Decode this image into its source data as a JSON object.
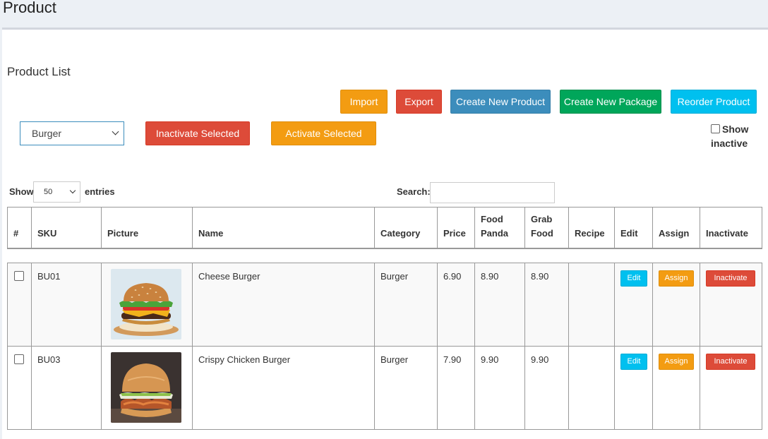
{
  "page": {
    "title": "Product"
  },
  "box": {
    "title": "Product List"
  },
  "toolbar": {
    "import_label": "Import",
    "export_label": "Export",
    "create_product_label": "Create New Product",
    "create_package_label": "Create New Package",
    "reorder_label": "Reorder Product",
    "category_selected": "Burger",
    "inactivate_selected_label": "Inactivate Selected",
    "activate_selected_label": "Activate Selected",
    "show_inactive_label": "Show inactive"
  },
  "datatable": {
    "show_label": "Show",
    "entries_value": "50",
    "entries_label": "entries",
    "search_label": "Search:",
    "search_value": ""
  },
  "table": {
    "headers": [
      "#",
      "SKU",
      "Picture",
      "Name",
      "Category",
      "Price",
      "Food Panda",
      "Grab Food",
      "Recipe",
      "Edit",
      "Assign",
      "Inactivate"
    ],
    "rows": [
      {
        "sku": "BU01",
        "picture": "cheese-burger-image",
        "name": "Cheese Burger",
        "category": "Burger",
        "price": "6.90",
        "food_panda": "8.90",
        "grab_food": "8.90",
        "recipe": "",
        "edit": "Edit",
        "assign": "Assign",
        "inactivate": "Inactivate"
      },
      {
        "sku": "BU03",
        "picture": "crispy-chicken-burger-image",
        "name": "Crispy Chicken Burger",
        "category": "Burger",
        "price": "7.90",
        "food_panda": "9.90",
        "grab_food": "9.90",
        "recipe": "",
        "edit": "Edit",
        "assign": "Assign",
        "inactivate": "Inactivate"
      }
    ]
  },
  "colors": {
    "warning": "#f39c12",
    "danger": "#dd4b39",
    "primary": "#3c8dbc",
    "success": "#00a65a",
    "info": "#00c0ef"
  }
}
